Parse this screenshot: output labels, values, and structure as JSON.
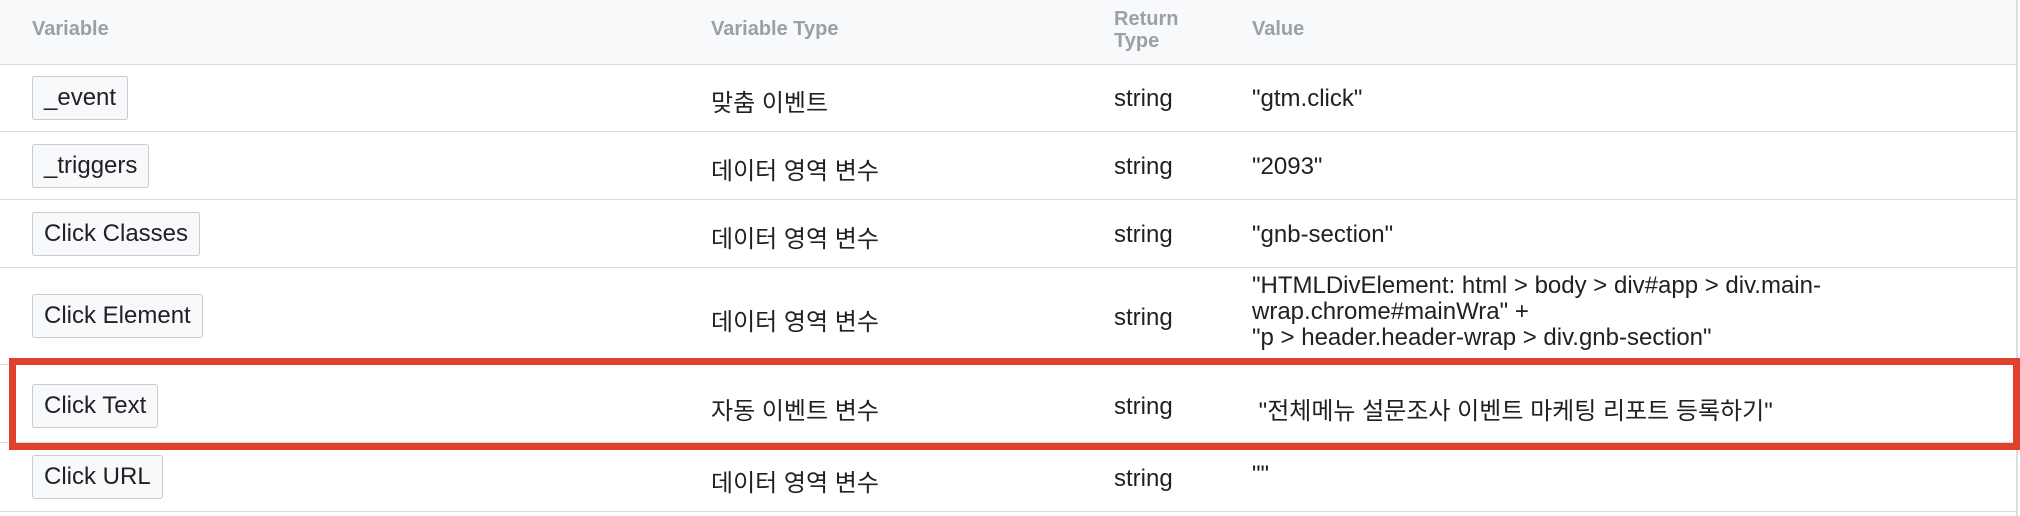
{
  "headers": {
    "variable": "Variable",
    "variable_type": "Variable Type",
    "return_type_line1": "Return",
    "return_type_line2": "Type",
    "value": "Value"
  },
  "rows": [
    {
      "variable": "_event",
      "type": "맞춤 이벤트",
      "return_type": "string",
      "value": "\"gtm.click\""
    },
    {
      "variable": "_triggers",
      "type": "데이터 영역 변수",
      "return_type": "string",
      "value": "\"2093\""
    },
    {
      "variable": "Click Classes",
      "type": "데이터 영역 변수",
      "return_type": "string",
      "value": "\"gnb-section\""
    },
    {
      "variable": "Click Element",
      "type": "데이터 영역 변수",
      "return_type": "string",
      "value_lines": [
        "\"HTMLDivElement: html > body > div#app > div.main-",
        "wrap.chrome#mainWra\" +",
        "\"p > header.header-wrap > div.gnb-section\""
      ]
    },
    {
      "variable": "Click Text",
      "type": "자동 이벤트 변수",
      "return_type": "string",
      "value": " \"전체메뉴 설문조사 이벤트 마케팅 리포트 등록하기\"",
      "highlighted": true
    },
    {
      "variable": "Click URL",
      "type": "데이터 영역 변수",
      "return_type": "string",
      "value": "\"\""
    }
  ],
  "colors": {
    "highlight_border": "#e0402d",
    "header_bg": "#f8f9fa",
    "header_text": "#9aa0a6",
    "divider": "#dadce0"
  }
}
